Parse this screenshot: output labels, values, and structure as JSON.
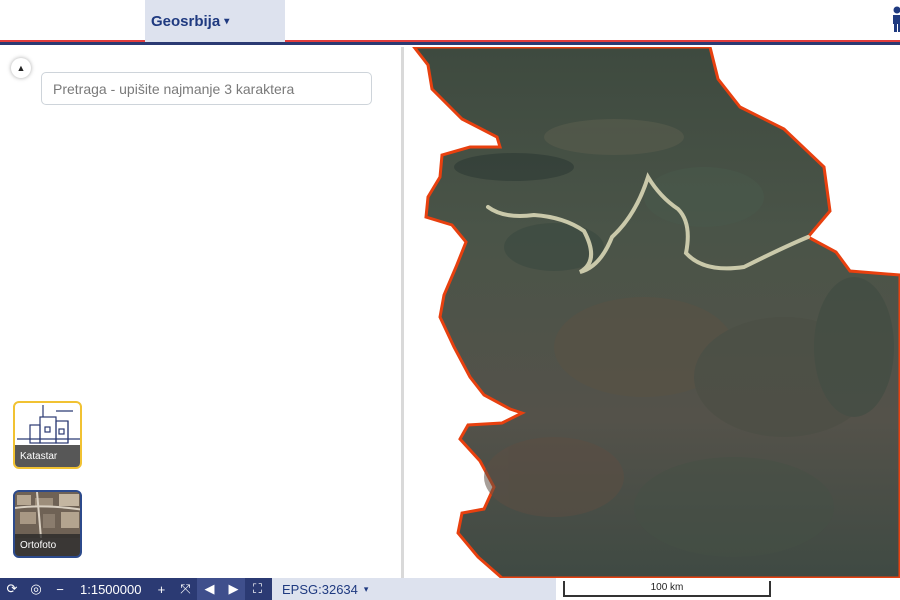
{
  "header": {
    "menu_label": "Geosrbija",
    "caret": "▾"
  },
  "sidebar": {
    "collapse_icon": "▲",
    "search": {
      "placeholder": "Pretraga - upišite najmanje 3 karaktera",
      "value": ""
    },
    "layers": [
      {
        "label": "Katastar",
        "selected": true,
        "accent": "#f1c232"
      },
      {
        "label": "Ortofoto",
        "selected": false,
        "accent": "#2c4a8c"
      }
    ]
  },
  "toolbar": {
    "refresh": "⟳",
    "locate": "◎",
    "zoom_out": "−",
    "scale": "1:1500000",
    "zoom_in": "+",
    "extent": "⤧",
    "prev": "◀",
    "next": "▶",
    "fullscreen": "⛶"
  },
  "crs": {
    "label": "EPSG:32634",
    "caret": "▾"
  },
  "map": {
    "scalebar_label": "100 km",
    "border_color": "#e8400f"
  },
  "colors": {
    "brand": "#2b3a73",
    "accent_red": "#e23d3d"
  }
}
